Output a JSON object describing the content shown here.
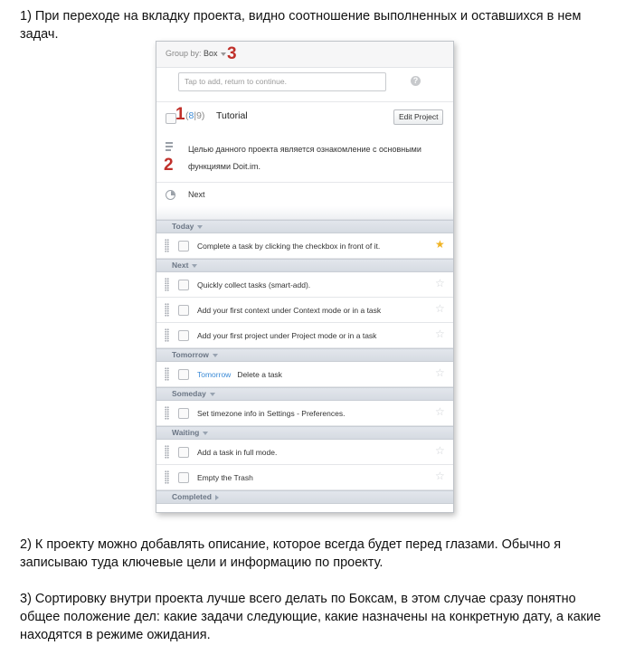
{
  "paragraphs": {
    "p1": "1) При переходе на вкладку проекта, видно соотношение выполненных и оставшихся в нем задач.",
    "p2": "2) К проекту можно добавлять описание, которое всегда будет перед глазами. Обычно я записываю туда ключевые цели и информацию по проекту.",
    "p3": "3) Сортировку внутри проекта лучше всего делать по Боксам, в этом случае сразу понятно общее положение дел: какие задачи следующие, какие назначены на конкретную дату, а какие находятся в режиме ожидания."
  },
  "screenshot": {
    "group_by_label": "Group by:",
    "group_by_value": "Box",
    "add_placeholder": "Tap to add, return to continue.",
    "help_glyph": "?",
    "annotations": {
      "one": "1",
      "two": "2",
      "three": "3"
    },
    "project": {
      "done_count": "8",
      "separator": "|",
      "remaining_count": "9",
      "name": "Tutorial",
      "edit_button": "Edit Project"
    },
    "description": "Целью данного проекта является ознакомление с основными функциями Doit.im.",
    "next_label": "Next",
    "sections": [
      {
        "label": "Today",
        "tasks": [
          {
            "due": "",
            "text": "Complete a task by clicking the checkbox in front of it.",
            "starred": true
          }
        ]
      },
      {
        "label": "Next",
        "tasks": [
          {
            "due": "",
            "text": "Quickly collect tasks (smart-add).",
            "starred": false
          },
          {
            "due": "",
            "text": "Add your first context under Context mode or in a task",
            "starred": false
          },
          {
            "due": "",
            "text": "Add your first project under Project mode or in a task",
            "starred": false
          }
        ]
      },
      {
        "label": "Tomorrow",
        "tasks": [
          {
            "due": "Tomorrow",
            "text": "Delete a task",
            "starred": false
          }
        ]
      },
      {
        "label": "Someday",
        "tasks": [
          {
            "due": "",
            "text": "Set timezone info in Settings - Preferences.",
            "starred": false
          }
        ]
      },
      {
        "label": "Waiting",
        "tasks": [
          {
            "due": "",
            "text": "Add a task in full mode.",
            "starred": false
          },
          {
            "due": "",
            "text": "Empty the Trash",
            "starred": false
          }
        ]
      },
      {
        "label": "Completed",
        "collapsed": true,
        "tasks": []
      }
    ]
  },
  "colors": {
    "accent": "#3a8ad6",
    "annotation": "#c0302a",
    "star_on": "#f0b323"
  }
}
